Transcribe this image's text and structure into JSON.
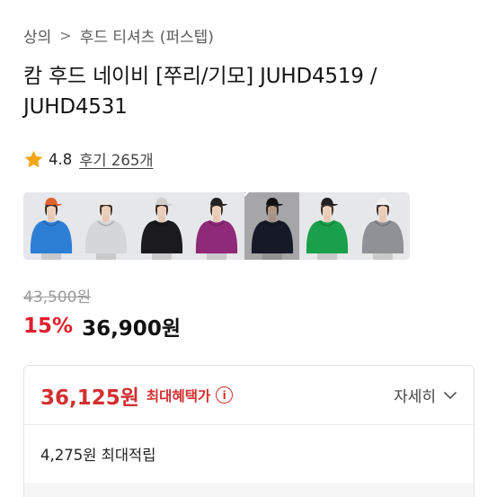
{
  "breadcrumb": {
    "level1": "상의",
    "level2": "후드 티셔츠 (퍼스텝)"
  },
  "product": {
    "title": "캄 후드 네이비 [쭈리/기모] JUHD4519 / JUHD4531"
  },
  "rating": {
    "score": "4.8",
    "reviews": "후기 265개",
    "star_color": "#f2a516"
  },
  "swatches": [
    {
      "name": "blue",
      "hoodie": "#2d7fd6",
      "bg": "#e5e7ea",
      "cap": "#e0612f",
      "selected": false
    },
    {
      "name": "light-gray",
      "hoodie": "#d4d6d9",
      "bg": "#e6e7e9",
      "cap": "#e8e8e8",
      "selected": false
    },
    {
      "name": "black",
      "hoodie": "#1b1b1d",
      "bg": "#e6e7e9",
      "cap": "#cfcfcf",
      "selected": false
    },
    {
      "name": "purple",
      "hoodie": "#8e2a78",
      "bg": "#e6e7e9",
      "cap": "#222222",
      "selected": false
    },
    {
      "name": "navy",
      "hoodie": "#1f2436",
      "bg": "#e6e7e9",
      "cap": "#1a1a1a",
      "selected": true
    },
    {
      "name": "green",
      "hoodie": "#1aa04c",
      "bg": "#e6e7e9",
      "cap": "#222222",
      "selected": false
    },
    {
      "name": "gray",
      "hoodie": "#8f9196",
      "bg": "#e6e7e9",
      "cap": "#efefef",
      "selected": false
    }
  ],
  "price": {
    "original": "43,500원",
    "discount": "15%",
    "sale": "36,900원"
  },
  "benefit": {
    "best_price": "36,125원",
    "best_label": "최대혜택가",
    "info_glyph": "i",
    "detail": "자세히",
    "points": "4,275원 최대적립",
    "accent_color": "#d42f2f"
  }
}
